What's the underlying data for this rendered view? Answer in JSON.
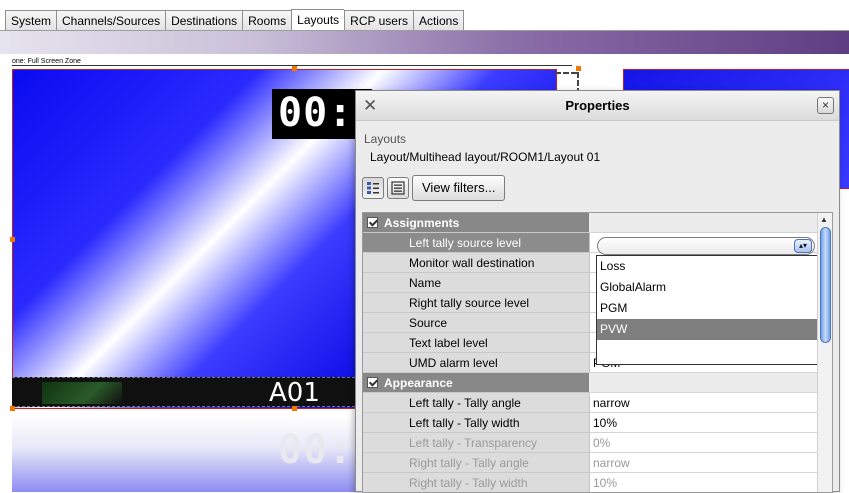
{
  "tabs": [
    "System",
    "Channels/Sources",
    "Destinations",
    "Rooms",
    "Layouts",
    "RCP users",
    "Actions"
  ],
  "active_tab": "Layouts",
  "canvas": {
    "zone_label": "one: Full Screen Zone",
    "timer_text_top": "00:",
    "timer_text_bottom": "00:",
    "umd_label": "A01"
  },
  "dialog": {
    "title": "Properties",
    "close_glyph": "×",
    "app_icon_glyph": "✕",
    "breadcrumb_heading": "Layouts",
    "breadcrumb_path": "Layout/Multihead layout/ROOM1/Layout 01",
    "view_filters_label": "View filters...",
    "sections": [
      {
        "name": "Assignments",
        "rows": [
          {
            "key": "Left tally source level",
            "value": ""
          },
          {
            "key": "Monitor wall destination",
            "value": ""
          },
          {
            "key": "Name",
            "value": ""
          },
          {
            "key": "Right tally source level",
            "value": ""
          },
          {
            "key": "Source",
            "value": ""
          },
          {
            "key": "Text label level",
            "value": ""
          },
          {
            "key": "UMD alarm level",
            "value": "PGM"
          }
        ]
      },
      {
        "name": "Appearance",
        "rows": [
          {
            "key": "Left tally - Tally angle",
            "value": "narrow"
          },
          {
            "key": "Left tally - Tally width",
            "value": "10%"
          },
          {
            "key": "Left tally - Transparency",
            "value": "0%"
          },
          {
            "key": "Right tally - Tally angle",
            "value": "narrow"
          },
          {
            "key": "Right tally - Tally width",
            "value": "10%"
          }
        ]
      }
    ],
    "dropdown_options": [
      "Loss",
      "GlobalAlarm",
      "PGM",
      "PVW",
      ""
    ],
    "dropdown_selected": "PVW"
  },
  "colors": {
    "accent_purple": "#5f3d82",
    "tile_blue": "#0a0af0",
    "selection_gray": "#7e7e7e",
    "handle_orange": "#f07800"
  }
}
